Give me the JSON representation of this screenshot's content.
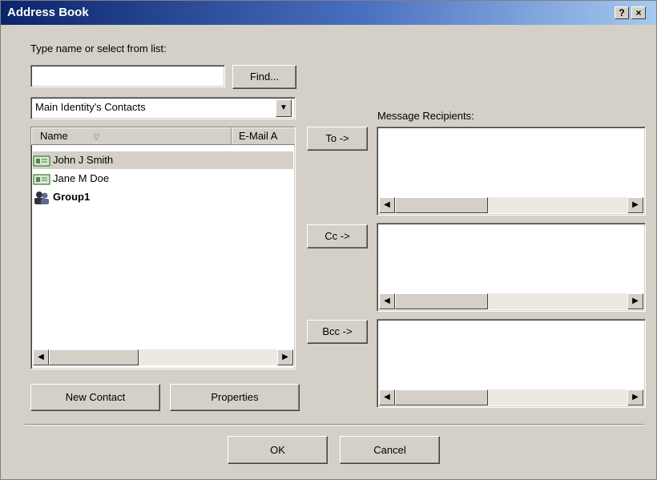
{
  "window": {
    "title": "Address Book",
    "help_button": "?",
    "close_button": "×"
  },
  "search": {
    "label": "Type name or select from list:",
    "value": "",
    "find_button": "Find..."
  },
  "folder_select": {
    "selected": "Main Identity's Contacts"
  },
  "contacts_list": {
    "columns": [
      "Name",
      "E-Mail A"
    ],
    "sort_indicator": "▽",
    "items": [
      {
        "name": "John J Smith",
        "icon": "contact-card-icon",
        "type": "contact",
        "selected": true
      },
      {
        "name": "Jane M Doe",
        "icon": "contact-card-icon",
        "type": "contact",
        "selected": false
      },
      {
        "name": "Group1",
        "icon": "group-icon",
        "type": "group",
        "selected": false
      }
    ]
  },
  "recipients": {
    "label": "Message Recipients:",
    "to_button": "To ->",
    "cc_button": "Cc ->",
    "bcc_button": "Bcc ->"
  },
  "actions": {
    "new_contact": "New Contact",
    "properties": "Properties",
    "ok": "OK",
    "cancel": "Cancel"
  },
  "colors": {
    "titlebar_start": "#0a246a",
    "titlebar_end": "#a6caf0",
    "face": "#d4d0c8"
  }
}
